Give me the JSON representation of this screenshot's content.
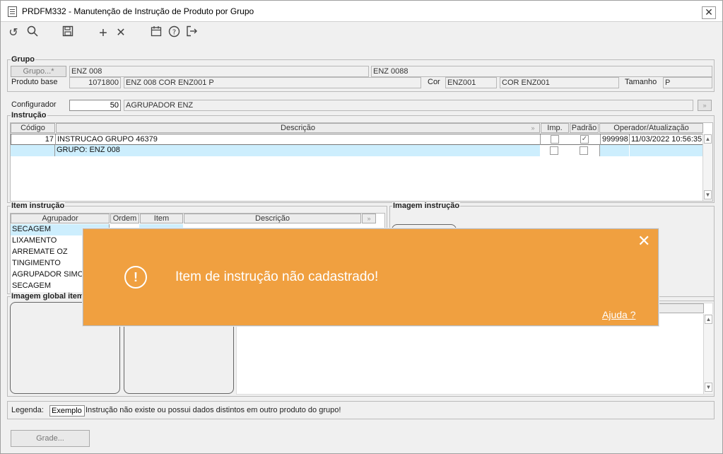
{
  "window": {
    "title": "PRDFM332 - Manutenção de Instrução de Produto por Grupo"
  },
  "toolbar": {
    "undo_icon": "undo-icon",
    "search_icon": "search-icon",
    "save_icon": "save-icon",
    "add_icon": "plus-icon",
    "delete_icon": "close-icon",
    "calendar_icon": "calendar-icon",
    "help_icon": "help-icon",
    "exit_icon": "exit-icon"
  },
  "grupo": {
    "legend": "Grupo",
    "grupo_button": "Grupo...*",
    "grupo_code": "ENZ 008",
    "grupo_desc": "ENZ 0088",
    "produto_base_label": "Produto base",
    "produto_base_code": "1071800",
    "produto_base_desc": "ENZ 008 COR ENZ001 P",
    "cor_label": "Cor",
    "cor_code": "ENZ001",
    "cor_desc": "COR ENZ001",
    "tamanho_label": "Tamanho",
    "tamanho_value": "P"
  },
  "configurador": {
    "label": "Configurador",
    "code": "50",
    "desc": "AGRUPADOR ENZ"
  },
  "instrucao": {
    "legend": "Instrução",
    "headers": {
      "codigo": "Código",
      "descricao": "Descrição",
      "imp": "Imp.",
      "padrao": "Padrão",
      "operador": "Operador/Atualização"
    },
    "rows": [
      {
        "codigo": "17",
        "descricao": "INSTRUCAO GRUPO 46379",
        "imp": false,
        "padrao": true,
        "operador": "999998",
        "atualizacao": "11/03/2022 10:56:35"
      },
      {
        "codigo": "",
        "descricao": "GRUPO: ENZ 008",
        "imp": false,
        "padrao": false,
        "operador": "",
        "atualizacao": ""
      }
    ]
  },
  "item_instrucao": {
    "legend": "Item instrução",
    "headers": {
      "agrupador": "Agrupador",
      "ordem": "Ordem",
      "item": "Item",
      "descricao": "Descrição"
    },
    "rows": [
      {
        "agrupador": "SECAGEM"
      },
      {
        "agrupador": "LIXAMENTO"
      },
      {
        "agrupador": "ARREMATE OZ"
      },
      {
        "agrupador": "TINGIMENTO"
      },
      {
        "agrupador": "AGRUPADOR  SIMON"
      },
      {
        "agrupador": "SECAGEM"
      }
    ]
  },
  "imagem_instrucao": {
    "legend": "Imagem instrução"
  },
  "imagem_global": {
    "legend": "Imagem global item"
  },
  "legenda": {
    "label": "Legenda:",
    "example": "Exemplo",
    "text": "Instrução não existe ou possui dados distintos em outro produto do grupo!"
  },
  "grade_button": "Grade...",
  "toast": {
    "message": "Item de instrução não cadastrado!",
    "help_link": "Ajuda ?",
    "icon": "alert-circle-icon",
    "color": "#f0a040"
  }
}
